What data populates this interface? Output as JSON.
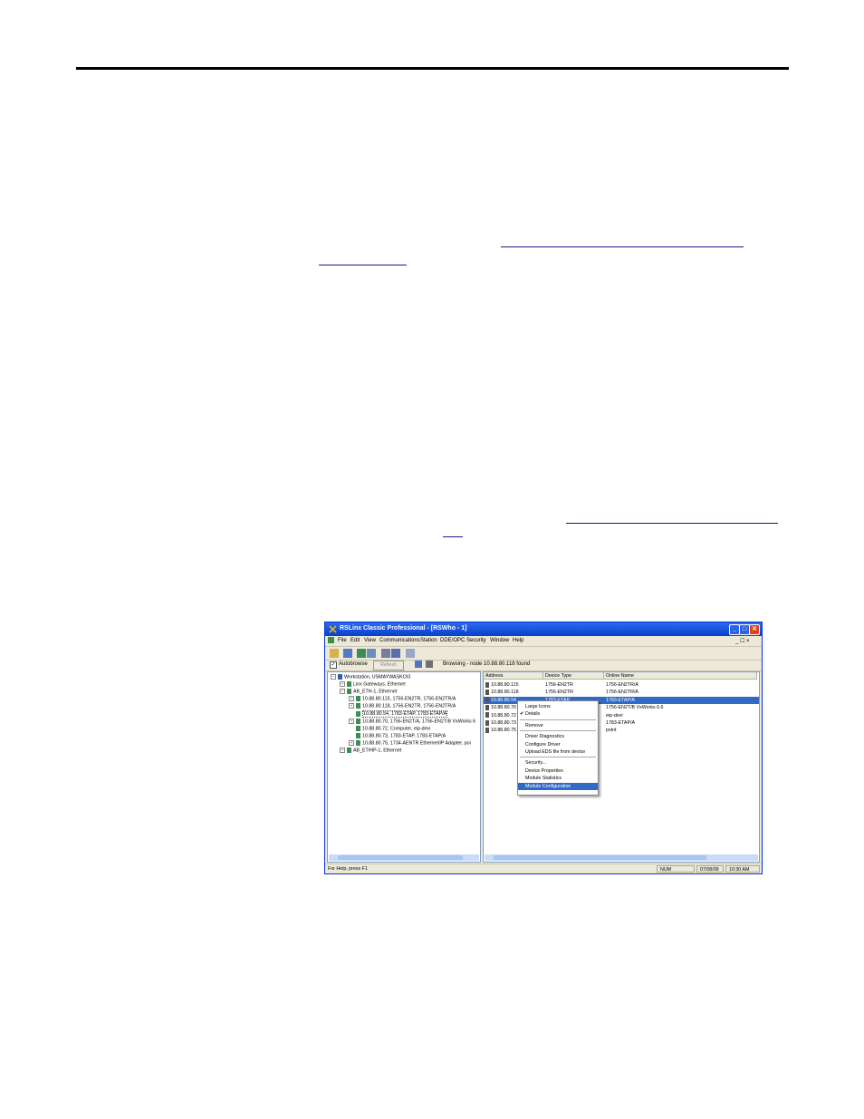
{
  "window": {
    "title": "RSLinx Classic Professional - [RSWho - 1]",
    "controls": [
      "_",
      "□",
      "✕"
    ],
    "menu": [
      "File",
      "Edit",
      "View",
      "Communications",
      "Station",
      "DDE/OPC",
      "Security",
      "Window",
      "Help"
    ],
    "mdi_controls": "_ ☐ ×",
    "autobrowse_label": "Autobrowse",
    "autobrowse_checked": "✓",
    "refresh_label": "Refresh",
    "browsing_status": "Browsing - node 10.88.80.118 found"
  },
  "tree": [
    {
      "label": "Workstation, USMAYWASKOI3",
      "toggle": "−",
      "indent": 0
    },
    {
      "label": "Linx Gateways, Ethernet",
      "toggle": "+",
      "indent": 1
    },
    {
      "label": "AB_ETH-1, Ethernet",
      "toggle": "−",
      "indent": 1
    },
    {
      "label": "10.88.80.115, 1756-EN2TR, 1756-EN2TR/A",
      "toggle": "+",
      "indent": 2
    },
    {
      "label": "10.88.80.118, 1756-EN2TR, 1756-EN2TR/A",
      "toggle": "+",
      "indent": 2
    },
    {
      "label": "10.88.80.54, 1783-ETAP, 1783-ETAP/A",
      "toggle": "",
      "indent": 2
    },
    {
      "label": "10.88.80.70, 1756-EN2T/A, 1756-EN2T/B VxWorks 6",
      "toggle": "+",
      "indent": 2
    },
    {
      "label": "10.88.80.72, Computer, eip-devi",
      "toggle": "",
      "indent": 2
    },
    {
      "label": "10.88.80.73, 1783-ETAP, 1783-ETAP/A",
      "toggle": "",
      "indent": 2
    },
    {
      "label": "10.88.80.75, 1734-AENTR Ethernet/IP Adapter, poi",
      "toggle": "+",
      "indent": 2
    },
    {
      "label": "AB_ETHIP-1, Ethernet",
      "toggle": "+",
      "indent": 1
    }
  ],
  "list": {
    "headers": [
      "Address",
      "Device Type",
      "Online Name"
    ],
    "rows": [
      [
        "10.88.80.115",
        "1756-EN2TR",
        "1756-EN2TR/A"
      ],
      [
        "10.88.80.118",
        "1756-EN2TR",
        "1756-EN2TR/A"
      ],
      [
        "10.88.80.54",
        "1783-ETAP",
        "1783-ETAP/A"
      ],
      [
        "10.88.80.70",
        "",
        "1756-EN2T/B VxWorks 6.6"
      ],
      [
        "10.88.80.72",
        "",
        "eip-devi"
      ],
      [
        "10.88.80.73",
        "",
        "1783-ETAP/A"
      ],
      [
        "10.88.80.75",
        "",
        "point"
      ]
    ],
    "selected_row": 2
  },
  "context_menu": {
    "groups": [
      [
        "Large Icons",
        "Details"
      ],
      [
        "Remove"
      ],
      [
        "Driver Diagnostics",
        "Configure Driver",
        "Upload EDS file from device"
      ],
      [
        "Security...",
        "Device Properties",
        "Module Statistics",
        "Module Configuration"
      ]
    ],
    "checked_item": "Details",
    "highlighted_item": "Module Configuration",
    "check_mark": "✔"
  },
  "statusbar": {
    "help": "For Help, press F1",
    "num": "NUM",
    "date": "07/08/09",
    "time": "10:30 AM"
  },
  "colors": {
    "titlebar": "#0a3fc8",
    "selection": "#316ac5",
    "link": "#1a1a8c"
  }
}
